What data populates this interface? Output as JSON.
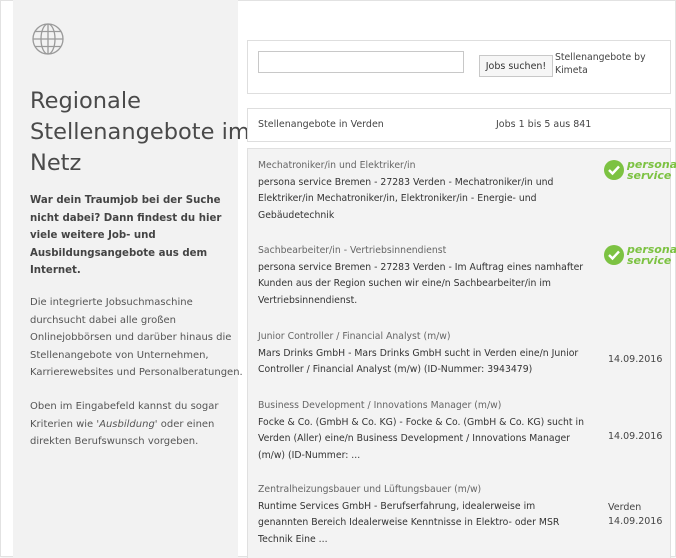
{
  "sidebar": {
    "title": "Regionale Stellenangebote im Netz",
    "lead": "War dein Traumjob bei der Suche nicht dabei? Dann findest du hier viele weitere Job- und Ausbildungsangebote aus dem Internet.",
    "paragraph1": "Die integrierte Jobsuchmaschine durchsucht dabei alle großen Onlinejobbörsen und darüber hinaus die Stellenangebote von Unternehmen, Karrierewebsites und Personalberatungen.",
    "paragraph2_before": "Oben im Eingabefeld kannst du sogar Kriterien wie ",
    "paragraph2_em": "'Ausbildung'",
    "paragraph2_after": " oder einen direkten Berufswunsch vorgeben.",
    "icon": "globe-icon"
  },
  "search": {
    "input_value": "",
    "input_placeholder": "",
    "button_label": "Jobs suchen!",
    "powered_by": "Stellenangebote by Kimeta"
  },
  "results": {
    "title": "Stellenangebote in Verden",
    "count": "Jobs 1 bis 5 aus 841"
  },
  "brand": {
    "logo_line1": "persona",
    "logo_line2": "service",
    "logo_color": "#7cc242"
  },
  "jobs": [
    {
      "title": "Mechatroniker/in und Elektriker/in",
      "description": "persona service Bremen - 27283 Verden - Mechatroniker/in und Elektriker/in Mechatroniker/in, Elektroniker/in - Energie- und Gebäudetechnik",
      "location": "",
      "date": "",
      "logo": true
    },
    {
      "title": "Sachbearbeiter/in - Vertriebsinnendienst",
      "description": "persona service Bremen - 27283 Verden - Im Auftrag eines namhafter Kunden aus der Region suchen wir eine/n Sachbearbeiter/in im Vertriebsinnendienst.",
      "location": "",
      "date": "",
      "logo": true
    },
    {
      "title": "Junior Controller / Financial Analyst (m/w)",
      "description": "Mars Drinks GmbH - Mars Drinks GmbH sucht in Verden eine/n Junior Controller / Financial Analyst (m/w) (ID-Nummer: 3943479)",
      "location": "",
      "date": "14.09.2016",
      "logo": false
    },
    {
      "title": "Business Development / Innovations Manager (m/w)",
      "description": "Focke & Co. (GmbH & Co. KG) - Focke & Co. (GmbH & Co. KG) sucht in Verden (Aller) eine/n Business Development / Innovations Manager (m/w) (ID-Nummer: ...",
      "location": "",
      "date": "14.09.2016",
      "logo": false
    },
    {
      "title": "Zentralheizungsbauer und Lüftungsbauer (m/w)",
      "description": "Runtime Services GmbH - Berufserfahrung, idealerweise im genannten Bereich Idealerweise Kenntnisse in Elektro- oder MSR Technik Eine ...",
      "location": "Verden",
      "date": "14.09.2016",
      "logo": false
    }
  ]
}
